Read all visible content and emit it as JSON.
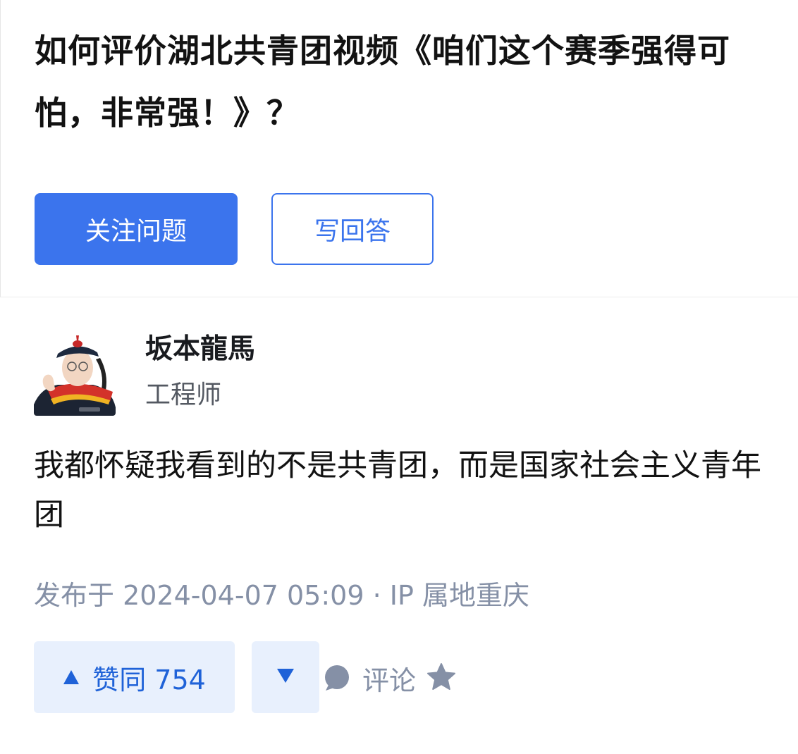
{
  "question": {
    "title": "如何评价湖北共青团视频《咱们这个赛季强得可怕，非常强！》？",
    "follow_label": "关注问题",
    "answer_label": "写回答"
  },
  "answer": {
    "author_name": "坂本龍馬",
    "author_bio": "工程师",
    "content": "我都怀疑我看到的不是共青团，而是国家社会主义青年团",
    "meta": "发布于 2024-04-07 05:09 · IP 属地重庆",
    "upvote_label": "赞同 754",
    "comment_label": "评论"
  },
  "icons": {
    "upvote": "triangle-up-icon",
    "downvote": "triangle-down-icon",
    "comment": "comment-bubble-icon",
    "favorite": "star-icon"
  },
  "colors": {
    "accent": "#3b74ed",
    "vote_bg": "#e8f0fd",
    "meta_text": "#8590a6"
  }
}
